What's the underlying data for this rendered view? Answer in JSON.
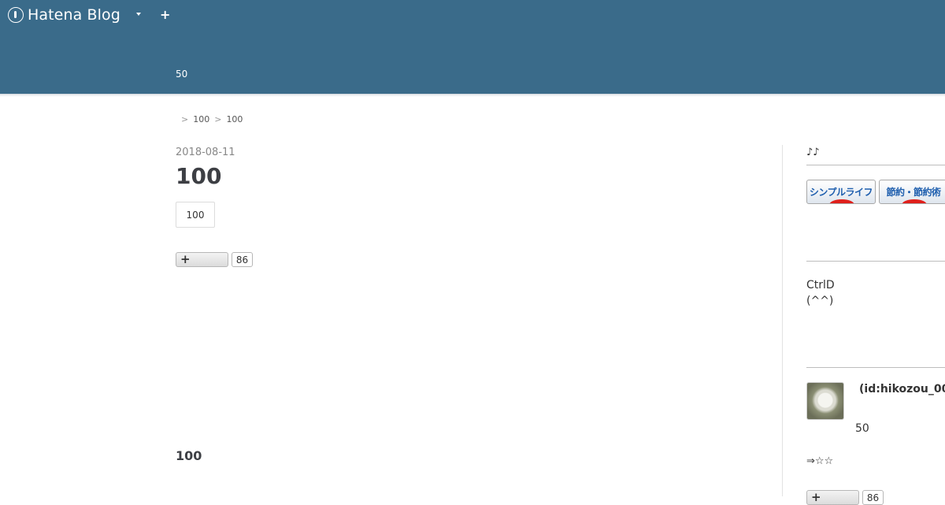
{
  "topbar": {
    "brand": "Hatena Blog",
    "add_symbol": "+"
  },
  "header": {
    "description": "50"
  },
  "breadcrumb": {
    "separator": ">",
    "items": [
      "100",
      "100"
    ]
  },
  "entry": {
    "date": "2018-08-11",
    "title": "100",
    "category": "100",
    "bookmark_count": "86",
    "section_heading": "100"
  },
  "sidebar": {
    "module_title": "♪♪",
    "banners": [
      {
        "label": "シンプルライフ"
      },
      {
        "label": "節約・節約術"
      }
    ],
    "text_lines": [
      "CtrlD",
      "(^^)"
    ],
    "profile": {
      "id": "(id:hikozou_00",
      "note": "50",
      "stars": "⇒☆☆"
    },
    "bookmark_count": "86"
  },
  "colors": {
    "header_bg": "#3a6b8a",
    "banner_text": "#1f5fae",
    "banner_red": "#e0201c"
  }
}
